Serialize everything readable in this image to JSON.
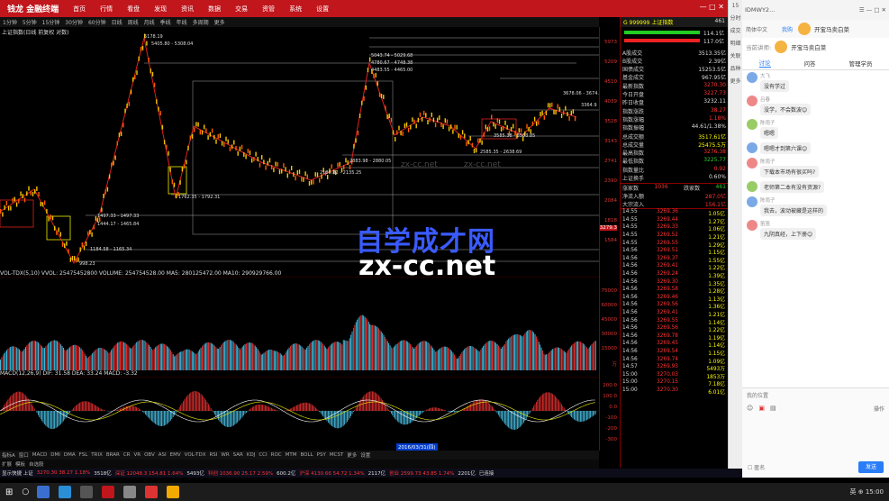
{
  "topbar": {
    "logo": "钱龙 金融终端",
    "menu": [
      "首页",
      "行情",
      "看盘",
      "发现",
      "资讯",
      "数据",
      "交易",
      "资管",
      "系统",
      "设置"
    ],
    "window_controls": "— □ ✕"
  },
  "timeframes": [
    "1分钟",
    "5分钟",
    "15分钟",
    "30分钟",
    "60分钟",
    "日线",
    "周线",
    "月线",
    "季线",
    "年线",
    "多周期",
    "更多"
  ],
  "chart": {
    "title": "上证指数(日线 前复权 对数)",
    "annotations": [
      "5178.19",
      "5405.80 - 5308.04",
      "5043.74 - 5029.68",
      "4780.67 - 4748.38",
      "4483.55 - 4465.00",
      "3678.06 - 3674.80",
      "3364.9",
      "3585.38 - 3583.85",
      "2585.35 - 2638.69",
      "2883.98 - 2880.05",
      "2180.82 - 2135.25",
      "1762.35 - 1792.31",
      "1497.33 - 1497.33",
      "1444.17 - 1465.84",
      "1184.58 - 1165.34",
      "998.23"
    ],
    "axis_labels": [
      "5973",
      "5209",
      "4510",
      "4039",
      "3528",
      "3143",
      "2741",
      "2390",
      "2084",
      "1818",
      "1584"
    ],
    "current_price_tag": "3279.3"
  },
  "volume": {
    "header": "VOL-TDX(5,10)  VVOL: 25475452800  VOLUME: 254754528.00  MA5: 280125472.00  MA10: 290929766.00",
    "axis_labels": [
      "75000",
      "60000",
      "45000",
      "30000",
      "15000",
      "万"
    ]
  },
  "macd": {
    "header": "MACD(12,26,9)  DIF: 31.58  DEA: 33.24  MACD: -3.32",
    "axis_labels": [
      "200.0",
      "100.0",
      "0.0",
      "-100",
      "-200",
      "-300"
    ]
  },
  "bottom_tabs": [
    "指标A",
    "窗口",
    "MACD",
    "DMI",
    "DMA",
    "FSL",
    "TRIX",
    "BRAR",
    "CR",
    "VR",
    "OBV",
    "ASI",
    "EMV",
    "VOL-TDX",
    "RSI",
    "WR",
    "SAR",
    "KDJ",
    "CCI",
    "ROC",
    "MTM",
    "BOLL",
    "PSY",
    "MCST",
    "更多",
    "设置"
  ],
  "bottom_tabs2": [
    "扩展",
    "模板",
    "自选股"
  ],
  "date_label": "2016/03/31(四)",
  "quote": {
    "header": "G 999999 上证指数",
    "header_num": "461",
    "bars": [
      {
        "label": "",
        "value": "114.1亿"
      },
      {
        "label": "",
        "value": "117.0亿"
      }
    ],
    "rows": [
      {
        "label": "A股成交",
        "value": "3513.35亿",
        "c": "w"
      },
      {
        "label": "B股成交",
        "value": "2.39亿",
        "c": "w"
      },
      {
        "label": "国债成交",
        "value": "15253.5亿",
        "c": "w"
      },
      {
        "label": "基金成交",
        "value": "967.95亿",
        "c": "w"
      },
      {
        "label": "最新指数",
        "value": "3270.30",
        "c": "r"
      },
      {
        "label": "今日开盘",
        "value": "3227.73",
        "c": "r"
      },
      {
        "label": "昨日收盘",
        "value": "3232.11",
        "c": "w"
      },
      {
        "label": "指数涨跌",
        "value": "38.27",
        "c": "r"
      },
      {
        "label": "指数涨幅",
        "value": "1.18%",
        "c": "r"
      },
      {
        "label": "指数振幅",
        "value": "44.61/1.38%",
        "c": "w"
      },
      {
        "label": "总成交额",
        "value": "3517.61亿",
        "c": "y"
      },
      {
        "label": "总成交量",
        "value": "25475.5万",
        "c": "y"
      },
      {
        "label": "最高指数",
        "value": "3276.38",
        "c": "r"
      },
      {
        "label": "最低指数",
        "value": "3225.77",
        "c": "g"
      },
      {
        "label": "指数量比",
        "value": "0.92",
        "c": "r"
      },
      {
        "label": "上证换手",
        "value": "0.60%",
        "c": "w"
      }
    ],
    "updown": {
      "up_label": "涨家数",
      "up": "1036",
      "down_label": "跌家数",
      "down": "461"
    },
    "flow": [
      {
        "label": "净流入额",
        "value": "287.0亿"
      },
      {
        "label": "大宗流入",
        "value": "156.1亿"
      }
    ],
    "ticks": [
      {
        "t": "14:55",
        "p": "3269.36",
        "v": "1.05亿"
      },
      {
        "t": "14:55",
        "p": "3269.44",
        "v": "1.27亿"
      },
      {
        "t": "14:55",
        "p": "3269.33",
        "v": "1.06亿"
      },
      {
        "t": "14:55",
        "p": "3269.52",
        "v": "1.21亿"
      },
      {
        "t": "14:55",
        "p": "3269.55",
        "v": "1.29亿"
      },
      {
        "t": "14:56",
        "p": "3269.51",
        "v": "1.15亿"
      },
      {
        "t": "14:56",
        "p": "3269.37",
        "v": "1.55亿"
      },
      {
        "t": "14:56",
        "p": "3269.41",
        "v": "1.22亿"
      },
      {
        "t": "14:56",
        "p": "3269.24",
        "v": "1.39亿"
      },
      {
        "t": "14:56",
        "p": "3269.30",
        "v": "1.35亿"
      },
      {
        "t": "14:56",
        "p": "3269.58",
        "v": "1.28亿"
      },
      {
        "t": "14:56",
        "p": "3269.46",
        "v": "1.13亿"
      },
      {
        "t": "14:56",
        "p": "3269.56",
        "v": "1.36亿"
      },
      {
        "t": "14:56",
        "p": "3269.41",
        "v": "1.21亿"
      },
      {
        "t": "14:56",
        "p": "3269.55",
        "v": "1.14亿"
      },
      {
        "t": "14:56",
        "p": "3269.56",
        "v": "1.22亿"
      },
      {
        "t": "14:56",
        "p": "3269.78",
        "v": "1.19亿"
      },
      {
        "t": "14:56",
        "p": "3269.45",
        "v": "1.14亿"
      },
      {
        "t": "14:56",
        "p": "3269.54",
        "v": "1.15亿"
      },
      {
        "t": "14:56",
        "p": "3269.74",
        "v": "1.09亿"
      },
      {
        "t": "14:57",
        "p": "3269.93",
        "v": "5493万"
      },
      {
        "t": "15:00",
        "p": "3270.03",
        "v": "1853万"
      },
      {
        "t": "15:00",
        "p": "3270.15",
        "v": "7.18亿"
      },
      {
        "t": "15:00",
        "p": "3270.30",
        "v": "6.01亿"
      }
    ]
  },
  "toolstrip": [
    "15",
    "分时",
    "成交",
    "明细",
    "关联",
    "品种",
    "更多"
  ],
  "chat": {
    "title": "IDMWY2...",
    "lang": "简体中文",
    "share": "我购",
    "room": "开宝马卖白菜",
    "lecturer_label": "当前讲师:",
    "lecturer": "开宝马卖白菜",
    "tabs": [
      "讨论",
      "问答",
      "管理学员"
    ],
    "messages": [
      {
        "name": "大飞",
        "text": "没有学过"
      },
      {
        "name": "吕春",
        "text": "没学，不会数波😊"
      },
      {
        "name": "陈雨子",
        "text": "嗯嗯"
      },
      {
        "name": "",
        "text": "嗯嗯才到第六课😊"
      },
      {
        "name": "陈雨子",
        "text": "下载本市场有很买吗?"
      },
      {
        "name": "",
        "text": "老师第二本有没有资源?"
      },
      {
        "name": "陈雨子",
        "text": "我去，波动被藏是这样的"
      },
      {
        "name": "笛笛",
        "text": "九阴真经，上下册😊"
      }
    ],
    "input_label": "我的位置",
    "anon_label": "匿名",
    "action_label": "操作",
    "send": "发送"
  },
  "statusbar": [
    {
      "t": "显示快捷 上证",
      "c": "w"
    },
    {
      "t": "3270.30 38.27 1.18%",
      "c": "r"
    },
    {
      "t": "3518亿",
      "c": "w"
    },
    {
      "t": "深证 12048.3 154.81 1.64%",
      "c": "r"
    },
    {
      "t": "5493亿",
      "c": "w"
    },
    {
      "t": "科创 1036.90 25.17 2.59%",
      "c": "r"
    },
    {
      "t": "600.2亿",
      "c": "w"
    },
    {
      "t": "沪深 4130.66 54.72 1.34%",
      "c": "r"
    },
    {
      "t": "2117亿",
      "c": "w"
    },
    {
      "t": "创业 2599.73 43.85 1.74%",
      "c": "r"
    },
    {
      "t": "2201亿",
      "c": "w"
    },
    {
      "t": "已连接",
      "c": "w"
    }
  ],
  "watermark": {
    "big": "自学成才网",
    "url": "zx-cc.net",
    "small": "zx-cc.net"
  },
  "taskbar": {
    "tray": "英 ⊕ 15:00"
  }
}
